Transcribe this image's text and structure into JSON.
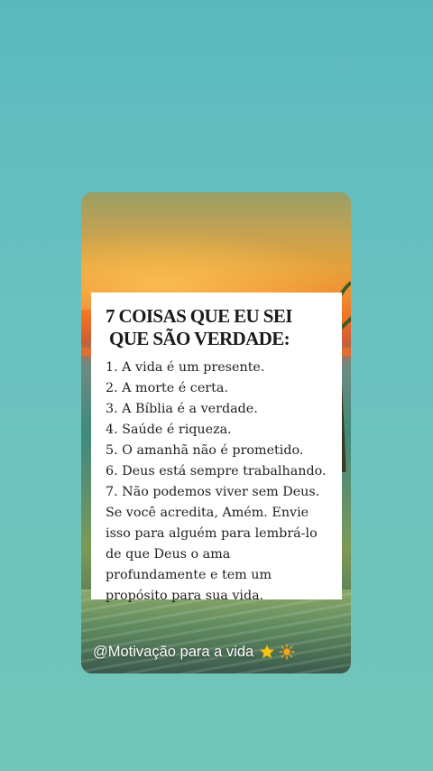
{
  "card": {
    "title_line1": "7 COISAS QUE EU SEI",
    "title_line2": "QUE SÃO VERDADE:",
    "items": [
      "1. A vida é um presente.",
      "2. A morte é certa.",
      "3. A Bíblia é a verdade.",
      "4. Saúde é riqueza.",
      "5. O amanhã não é prometido.",
      "6. Deus está sempre trabalhando.",
      "7. Não podemos viver sem Deus."
    ],
    "closing": "Se você acredita, Amém. Envie isso para alguém para lembrá-lo de que Deus o ama profundamente e tem um propósito para sua vida."
  },
  "watermark": {
    "text": "@Motivação para a vida",
    "icons": [
      "star-icon",
      "sun-icon"
    ]
  },
  "colors": {
    "background": "#62bdbd",
    "text": "#222222",
    "star": "#f5c518",
    "sun": "#f7a21b"
  }
}
